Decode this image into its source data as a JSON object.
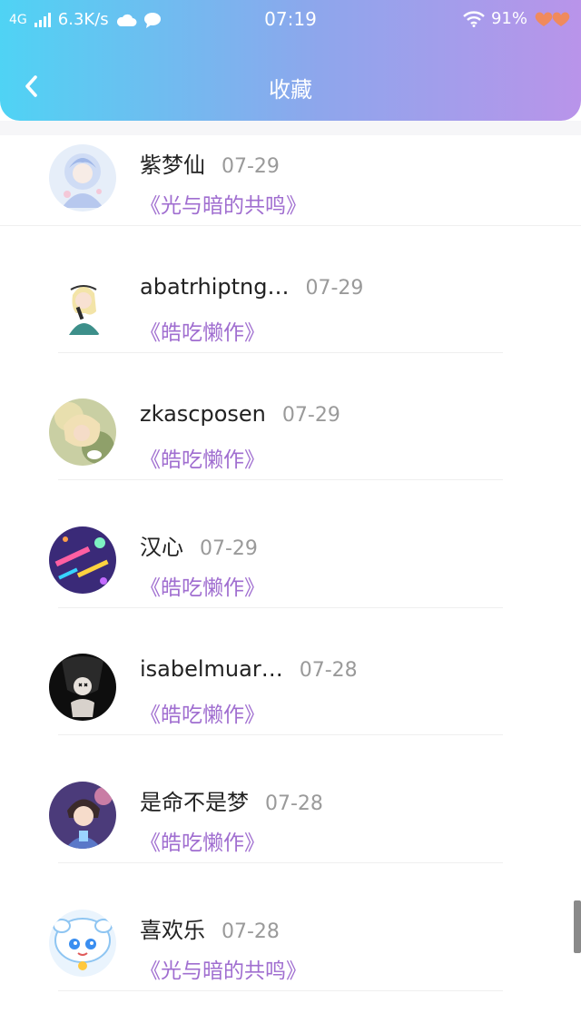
{
  "status_bar": {
    "network": "4G",
    "speed": "6.3K/s",
    "time": "07:19",
    "battery": "91%"
  },
  "nav": {
    "title": "收藏",
    "back_icon": "chevron-left-icon"
  },
  "colors": {
    "header_gradient": [
      "#4fd3f4",
      "#8ea6ec",
      "#b994ea"
    ],
    "work_title": "#a06ed0",
    "date": "#9a9a9a",
    "username": "#222222"
  },
  "favorites": [
    {
      "user": "紫梦仙",
      "date": "07-29",
      "work": "《光与暗的共鸣》"
    },
    {
      "user": "abatrhiptng…",
      "date": "07-29",
      "work": "《皓吃懒作》"
    },
    {
      "user": "zkascposen",
      "date": "07-29",
      "work": "《皓吃懒作》"
    },
    {
      "user": "汉心",
      "date": "07-29",
      "work": "《皓吃懒作》"
    },
    {
      "user": "isabelmuar…",
      "date": "07-28",
      "work": "《皓吃懒作》"
    },
    {
      "user": "是命不是梦",
      "date": "07-28",
      "work": "《皓吃懒作》"
    },
    {
      "user": "喜欢乐",
      "date": "07-28",
      "work": "《光与暗的共鸣》"
    }
  ]
}
